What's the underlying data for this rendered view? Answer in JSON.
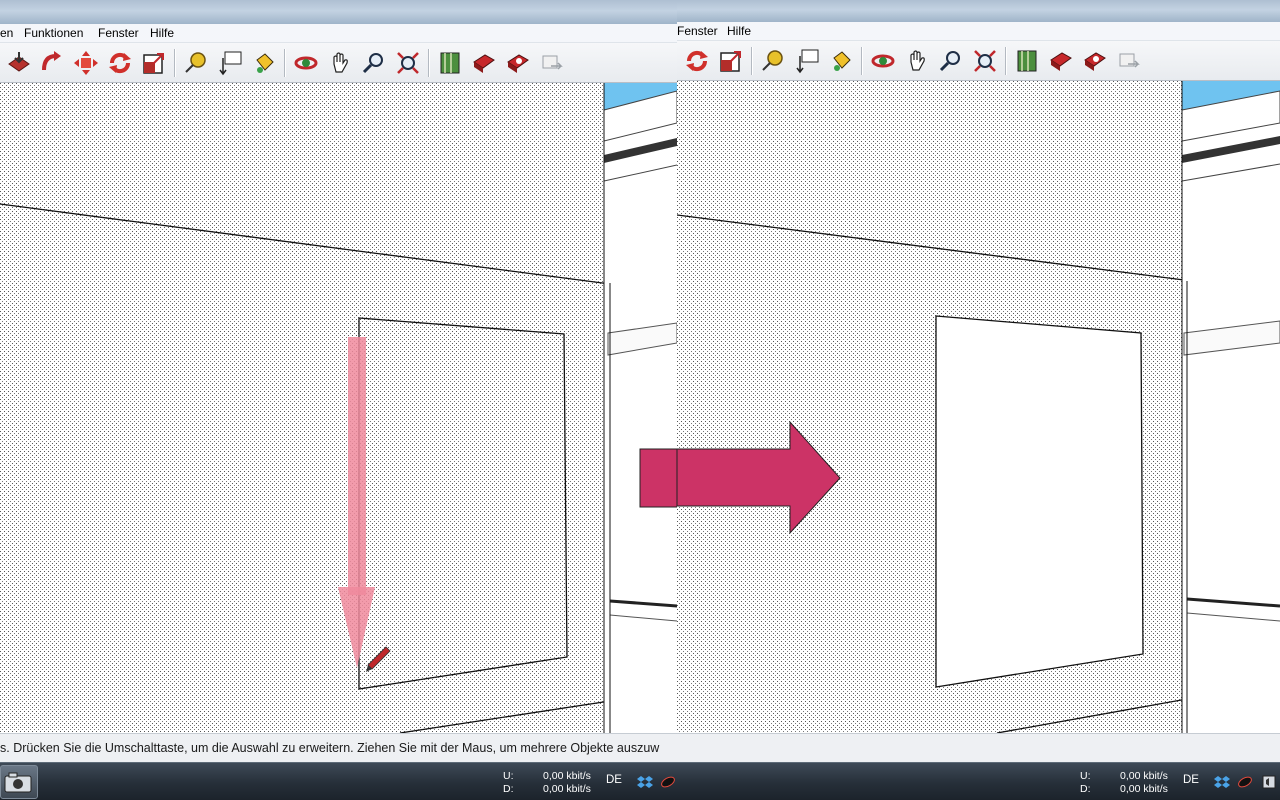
{
  "left_window": {
    "title": "",
    "menu": [
      "en",
      "Funktionen",
      "Fenster",
      "Hilfe"
    ],
    "status_text": "s. Drücken Sie die Umschalttaste, um die Auswahl zu erweitern. Ziehen Sie mit der Maus, um mehrere Objekte auszuw",
    "taskbar": {
      "up_label": "U:",
      "down_label": "D:",
      "up_value": "0,00 kbit/s",
      "down_value": "0,00 kbit/s",
      "lang": "DE"
    }
  },
  "right_window": {
    "menu": [
      "Fenster",
      "Hilfe"
    ],
    "taskbar": {
      "up_label": "U:",
      "down_label": "D:",
      "up_value": "0,00 kbit/s",
      "down_value": "0,00 kbit/s",
      "lang": "DE"
    }
  },
  "toolbar_icons_left": [
    "push-pull-icon",
    "follow-me-icon",
    "move-icon",
    "rotate-icon",
    "scale-icon",
    "tape-measure-icon",
    "text-icon",
    "paint-bucket-icon",
    "orbit-icon",
    "pan-icon",
    "zoom-icon",
    "zoom-extents-icon",
    "google-earth-icon",
    "get-models-icon",
    "share-model-icon",
    "component-icon"
  ],
  "toolbar_icons_right": [
    "rotate-icon",
    "scale-icon",
    "tape-measure-icon",
    "text-icon",
    "paint-bucket-icon",
    "orbit-icon",
    "pan-icon",
    "zoom-icon",
    "zoom-extents-icon",
    "google-earth-icon",
    "get-models-icon",
    "share-model-icon",
    "component-icon"
  ],
  "colors": {
    "transition_arrow": "#cc3366",
    "guide_arrow": "#f08a9c",
    "sky": "#6fc3f0",
    "taskbar": "#262f39"
  }
}
